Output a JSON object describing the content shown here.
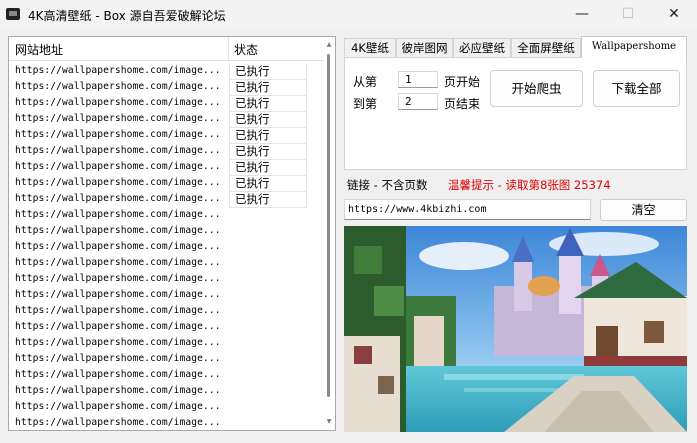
{
  "window": {
    "title": "4K高清壁纸 - Box   源自吾爱破解论坛",
    "minimize": "—",
    "maximize": "☐",
    "close": "✕"
  },
  "list": {
    "columns": [
      "网站地址",
      "状态"
    ],
    "rows": [
      {
        "url": "https://wallpapershome.com/image...",
        "status": "已执行"
      },
      {
        "url": "https://wallpapershome.com/image...",
        "status": "已执行"
      },
      {
        "url": "https://wallpapershome.com/image...",
        "status": "已执行"
      },
      {
        "url": "https://wallpapershome.com/image...",
        "status": "已执行"
      },
      {
        "url": "https://wallpapershome.com/image...",
        "status": "已执行"
      },
      {
        "url": "https://wallpapershome.com/image...",
        "status": "已执行"
      },
      {
        "url": "https://wallpapershome.com/image...",
        "status": "已执行"
      },
      {
        "url": "https://wallpapershome.com/image...",
        "status": "已执行"
      },
      {
        "url": "https://wallpapershome.com/image...",
        "status": "已执行"
      },
      {
        "url": "https://wallpapershome.com/image...",
        "status": ""
      },
      {
        "url": "https://wallpapershome.com/image...",
        "status": ""
      },
      {
        "url": "https://wallpapershome.com/image...",
        "status": ""
      },
      {
        "url": "https://wallpapershome.com/image...",
        "status": ""
      },
      {
        "url": "https://wallpapershome.com/image...",
        "status": ""
      },
      {
        "url": "https://wallpapershome.com/image...",
        "status": ""
      },
      {
        "url": "https://wallpapershome.com/image...",
        "status": ""
      },
      {
        "url": "https://wallpapershome.com/image...",
        "status": ""
      },
      {
        "url": "https://wallpapershome.com/image...",
        "status": ""
      },
      {
        "url": "https://wallpapershome.com/image...",
        "status": ""
      },
      {
        "url": "https://wallpapershome.com/image...",
        "status": ""
      },
      {
        "url": "https://wallpapershome.com/image...",
        "status": ""
      },
      {
        "url": "https://wallpapershome.com/image...",
        "status": ""
      },
      {
        "url": "https://wallpapershome.com/image...",
        "status": ""
      }
    ]
  },
  "tabs": {
    "items": [
      "4K壁纸",
      "彼岸图网",
      "必应壁纸",
      "全面屏壁纸",
      "Wallpapershome"
    ],
    "active_index": 4
  },
  "panel": {
    "from_label": "从第",
    "to_label": "到第",
    "from_value": "1",
    "to_value": "2",
    "page_start_label": "页开始",
    "page_end_label": "页结束",
    "start_button": "开始爬虫",
    "download_button": "下载全部"
  },
  "link_label": "链接 - 不含页数",
  "tip": "温馨提示 - 读取第8张图 25374",
  "url_value": "https://www.4kbizhi.com",
  "clear_button": "清空",
  "colors": {
    "tip": "#e00000",
    "accent_sky": "#5fa3e6"
  }
}
